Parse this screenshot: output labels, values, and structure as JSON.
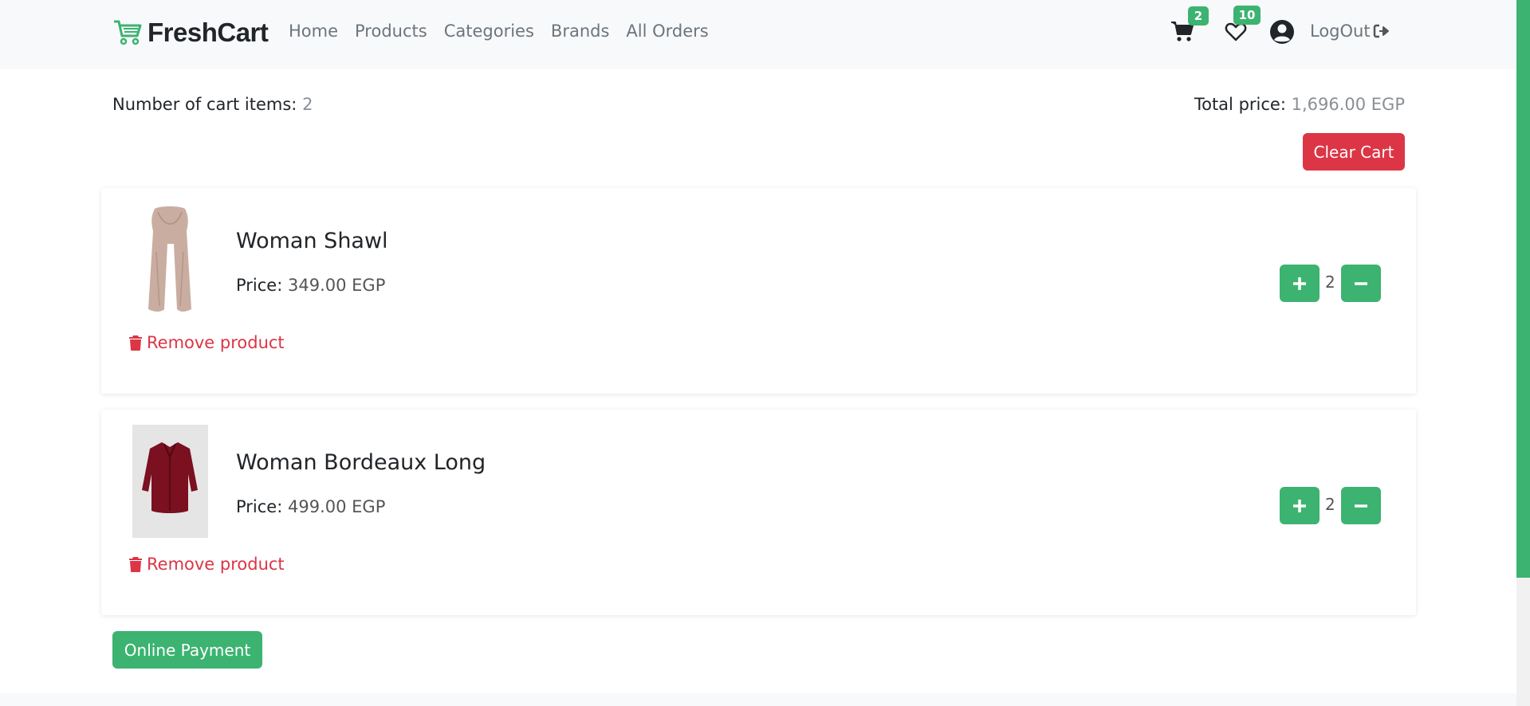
{
  "colors": {
    "accent": "#3cb371",
    "danger": "#dc3545",
    "muted": "#6c757d"
  },
  "brand": {
    "name": "FreshCart",
    "icon": "cart-logo-icon"
  },
  "nav": {
    "links": [
      "Home",
      "Products",
      "Categories",
      "Brands",
      "All Orders"
    ],
    "cart_count": "2",
    "wishlist_count": "10",
    "logout_label": "LogOut"
  },
  "summary": {
    "items_label": "Number of cart items:",
    "items_value": "2",
    "total_label": "Total price:",
    "total_value": "1,696.00 EGP",
    "clear_label": "Clear Cart"
  },
  "cart_items": [
    {
      "title": "Woman Shawl",
      "price_label": "Price:",
      "price_value": "349.00 EGP",
      "quantity": "2",
      "remove_label": "Remove product"
    },
    {
      "title": "Woman Bordeaux Long",
      "price_label": "Price:",
      "price_value": "499.00 EGP",
      "quantity": "2",
      "remove_label": "Remove product"
    }
  ],
  "payment": {
    "label": "Online Payment"
  }
}
